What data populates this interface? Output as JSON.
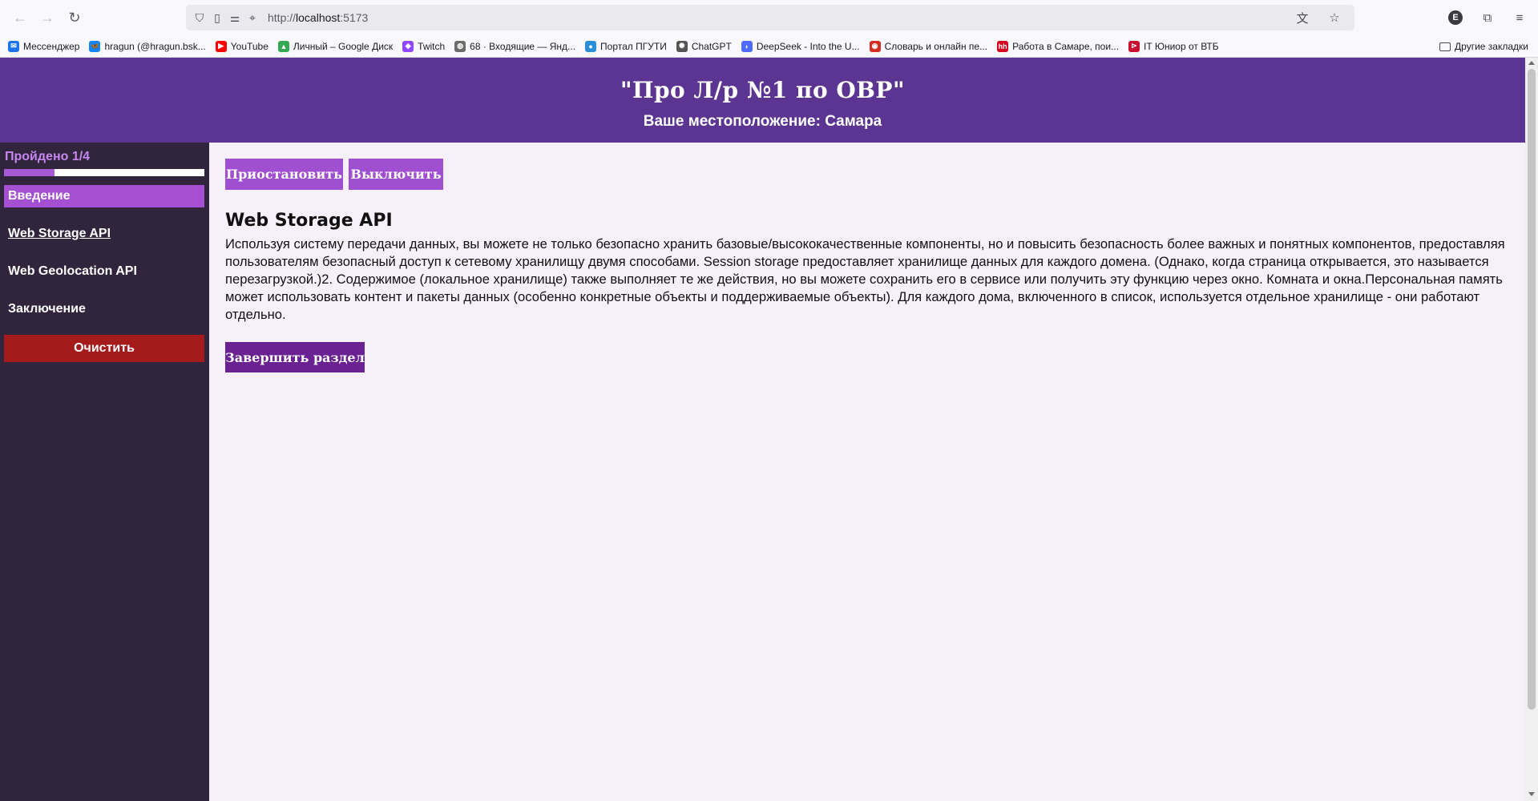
{
  "browser": {
    "url_scheme": "http://",
    "url_host": "localhost",
    "url_port": ":5173",
    "account_initial": "E",
    "icons": {
      "back": "arrow-left-icon",
      "forward": "arrow-right-icon",
      "reload": "reload-icon",
      "shield": "shield-icon",
      "page": "page-icon",
      "permissions": "permissions-icon",
      "location": "location-icon",
      "translate": "translate-icon",
      "bookmark": "star-icon",
      "extensions": "puzzle-icon",
      "menu": "hamburger-menu-icon"
    }
  },
  "bookmarks": [
    {
      "label": "Мессенджер",
      "icon": "messenger-icon",
      "color": "#1a73e8",
      "glyph": "✉"
    },
    {
      "label": "hragun (@hragun.bsk...",
      "icon": "bluesky-butterfly-icon",
      "color": "#1185fe",
      "glyph": "🦋"
    },
    {
      "label": "YouTube",
      "icon": "youtube-icon",
      "color": "#ff0000",
      "glyph": "▶"
    },
    {
      "label": "Личный – Google Диск",
      "icon": "google-drive-icon",
      "color": "#34a853",
      "glyph": "▲"
    },
    {
      "label": "Twitch",
      "icon": "twitch-icon",
      "color": "#9146ff",
      "glyph": "◆"
    },
    {
      "label": "68 · Входящие — Янд...",
      "icon": "globe-icon",
      "color": "#6b6b6b",
      "glyph": "◍"
    },
    {
      "label": "Портал ПГУТИ",
      "icon": "portal-icon",
      "color": "#2a8fd8",
      "glyph": "●"
    },
    {
      "label": "ChatGPT",
      "icon": "chatgpt-icon",
      "color": "#555555",
      "glyph": "✺"
    },
    {
      "label": "DeepSeek - Into the U...",
      "icon": "deepseek-icon",
      "color": "#4d6bfe",
      "glyph": "◗"
    },
    {
      "label": "Словарь и онлайн пе...",
      "icon": "dictionary-icon",
      "color": "#d62b1f",
      "glyph": "◉"
    },
    {
      "label": "Работа в Самаре, пои...",
      "icon": "hh-icon",
      "color": "#d6001c",
      "glyph": "hh"
    },
    {
      "label": "IT Юниор от ВТБ",
      "icon": "vtb-icon",
      "color": "#c8102e",
      "glyph": "⊳"
    }
  ],
  "bookmarks_other": "Другие закладки",
  "header": {
    "title": "\"Про Л/р №1 по ОВР\"",
    "location": "Ваше местоположение: Самара"
  },
  "sidebar": {
    "progress_label": "Пройдено 1/4",
    "progress_value": 0.25,
    "items": [
      {
        "label": "Введение",
        "active": true
      },
      {
        "label": "Web Storage API",
        "active": false
      },
      {
        "label": "Web Geolocation API",
        "active": false
      },
      {
        "label": "Заключение",
        "active": false
      }
    ],
    "clear_label": "Очистить"
  },
  "controls": {
    "pause_label": "Приостановить",
    "off_label": "Выключить"
  },
  "section": {
    "title": "Web Storage API",
    "text": "Используя систему передачи данных, вы можете не только безопасно хранить базовые/высококачественные компоненты, но и повысить безопасность более важных и понятных компонентов, предоставляя пользователям безопасный доступ к сетевому хранилищу двумя способами. Session storage предоставляет хранилище данных для каждого домена. (Однако, когда страница открывается, это называется перезагрузкой.)2. Содержимое (локальное хранилище) также выполняет те же действия, но вы можете сохранить его в сервисе или получить эту функцию через окно. Комната и окна.Персональная память может использовать контент и пакеты данных (особенно конкретные объекты и поддерживаемые объекты). Для каждого дома, включенного в список, используется отдельное хранилище - они работают отдельно.",
    "finish_label": "Завершить раздел"
  },
  "colors": {
    "header_bg": "#5c3592",
    "sidebar_bg": "#30253c",
    "accent": "#a54fd2",
    "danger": "#a51a1a",
    "finish_bg": "#6a2192",
    "page_bg": "#f6f0fa"
  }
}
